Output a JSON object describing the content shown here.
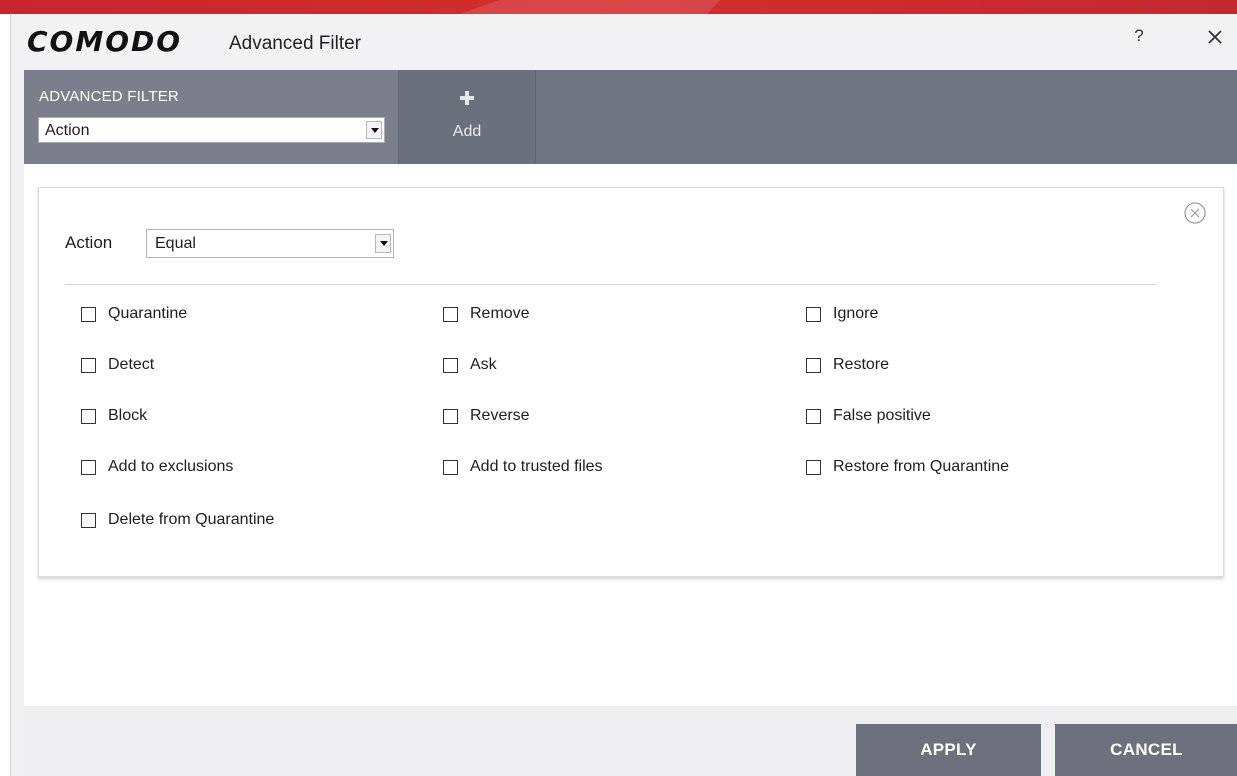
{
  "window": {
    "brand": "COMODO",
    "title": "Advanced Filter",
    "help_label": "?"
  },
  "toolbar": {
    "filter_label": "ADVANCED FILTER",
    "filter_value": "Action",
    "add_label": "Add"
  },
  "condition": {
    "label": "Action",
    "operator": "Equal"
  },
  "options": [
    {
      "label": "Quarantine",
      "checked": false
    },
    {
      "label": "Remove",
      "checked": false
    },
    {
      "label": "Ignore",
      "checked": false
    },
    {
      "label": "Detect",
      "checked": false
    },
    {
      "label": "Ask",
      "checked": false
    },
    {
      "label": "Restore",
      "checked": false
    },
    {
      "label": "Block",
      "checked": false
    },
    {
      "label": "Reverse",
      "checked": false
    },
    {
      "label": "False positive",
      "checked": false
    },
    {
      "label": "Add to exclusions",
      "checked": false
    },
    {
      "label": "Add to trusted files",
      "checked": false
    },
    {
      "label": "Restore from Quarantine",
      "checked": false
    },
    {
      "label": "Delete from Quarantine",
      "checked": false
    }
  ],
  "buttons": {
    "apply": "APPLY",
    "cancel": "CANCEL"
  },
  "colors": {
    "brand_red": "#c9252c",
    "toolbar_bg": "#6e7481",
    "button_bg": "#6c717d"
  }
}
